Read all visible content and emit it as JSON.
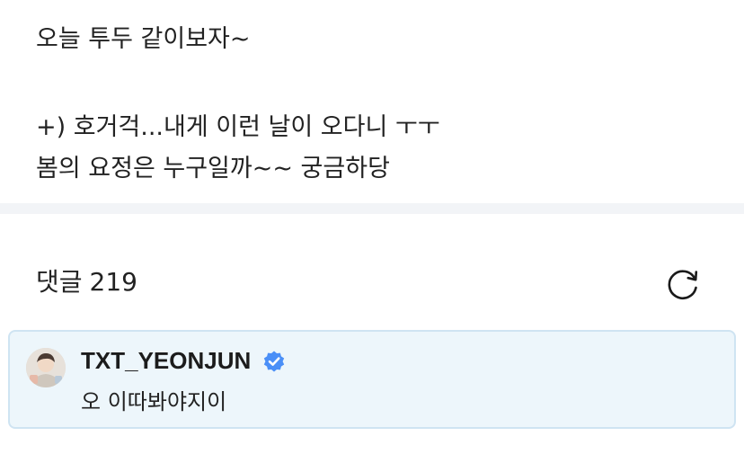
{
  "post": {
    "lines": [
      "오늘 투두 같이보자~",
      "+) 호거걱...내게 이런 날이 오다니 ㅜㅜ",
      "봄의 요정은 누구일까~~ 궁금하당"
    ]
  },
  "comments": {
    "label": "댓글",
    "count": "219",
    "refresh_icon": "refresh-icon",
    "items": [
      {
        "author": "TXT_YEONJUN",
        "verified": true,
        "text": "오 이따봐야지이",
        "highlighted": true
      }
    ]
  },
  "colors": {
    "text": "#222222",
    "divider": "#f2f4f7",
    "comment_highlight_bg": "#edf6fb",
    "comment_highlight_border": "#cfe4f2",
    "verified_badge": "#4a8ff7"
  }
}
